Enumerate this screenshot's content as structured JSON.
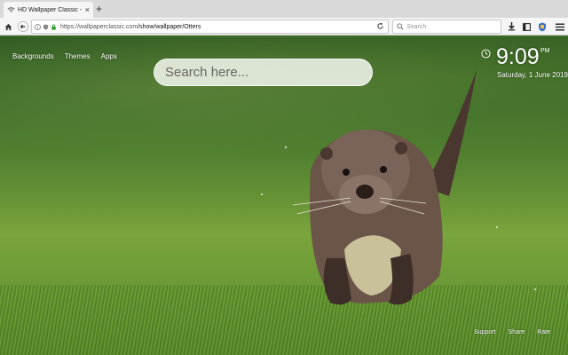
{
  "browser": {
    "tab_title": "HD Wallpaper Classic - Otters",
    "tab_close": "×",
    "new_tab": "+",
    "url_host": "https://wallpaperclassic.com",
    "url_path": "/show/wallpaper/Otters",
    "search_placeholder": "Search"
  },
  "nav": {
    "links": [
      "Backgrounds",
      "Themes",
      "Apps"
    ]
  },
  "search": {
    "placeholder": "Search here..."
  },
  "clock": {
    "time": "9:09",
    "ampm": "PM",
    "date": "Saturday, 1 June 2019"
  },
  "footer": {
    "links": [
      "Support",
      "Share",
      "Rate"
    ]
  },
  "colors": {
    "grass_light": "#7aa43c",
    "grass_dark": "#2f5a22",
    "otter_fur": "#6b5548"
  }
}
